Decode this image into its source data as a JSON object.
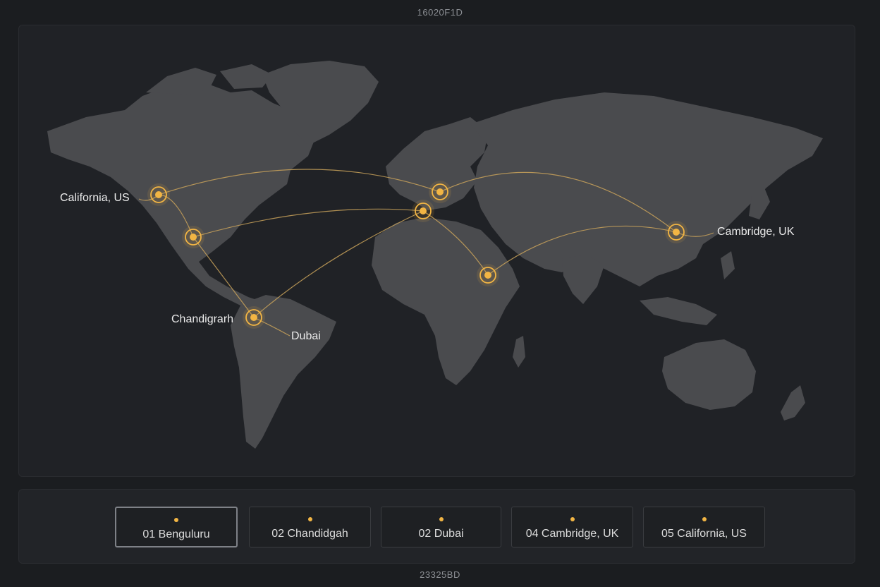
{
  "header": {
    "code": "16020F1D"
  },
  "footer": {
    "code": "23325BD"
  },
  "colors": {
    "accent": "#f2b544",
    "route": "#c9a25a",
    "land": "#4a4b4e",
    "background": "#1b1d20"
  },
  "map": {
    "labels": {
      "california": "California, US",
      "cambridge": "Cambridge, UK",
      "chandigarh": "Chandigrarh",
      "dubai": "Dubai"
    }
  },
  "tabs": [
    {
      "label": "01 Benguluru",
      "active": true
    },
    {
      "label": "02 Chandidgah",
      "active": false
    },
    {
      "label": "02 Dubai",
      "active": false
    },
    {
      "label": "04 Cambridge, UK",
      "active": false
    },
    {
      "label": "05 California, US",
      "active": false
    }
  ]
}
